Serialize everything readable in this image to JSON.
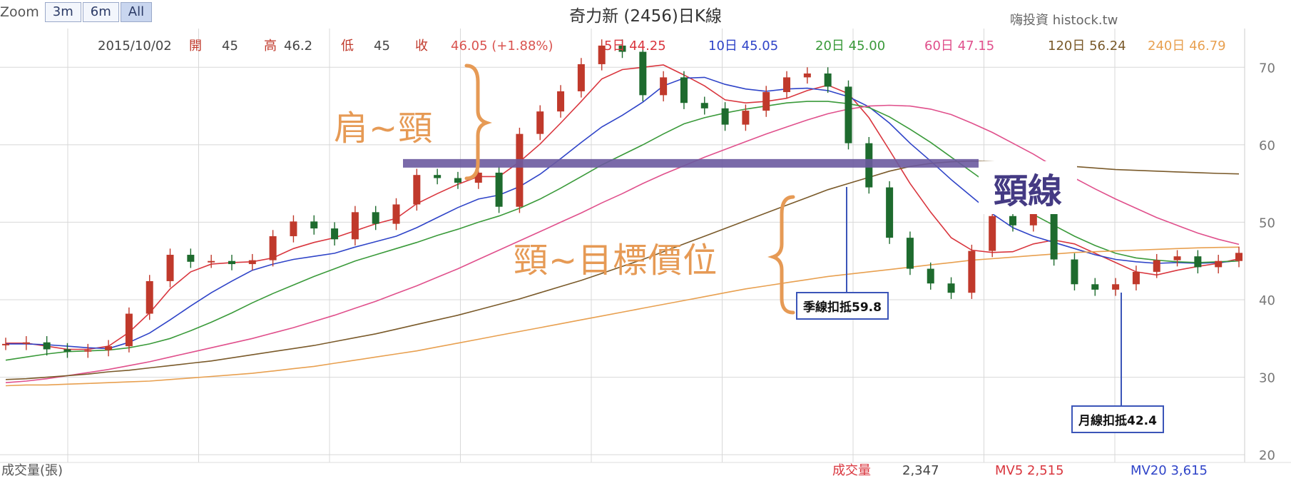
{
  "zoom": {
    "label": "Zoom",
    "buttons": [
      "3m",
      "6m",
      "All"
    ],
    "active": "All"
  },
  "title": "奇力新 (2456)日K線",
  "brand": "嗨投資 histock.tw",
  "info_bar": [
    {
      "text": "2015/10/02",
      "color": "#444444"
    },
    {
      "text": "開",
      "color": "#c0392b"
    },
    {
      "text": "45",
      "color": "#444444"
    },
    {
      "text": "高",
      "color": "#c0392b"
    },
    {
      "text": "46.2",
      "color": "#444444"
    },
    {
      "text": "低",
      "color": "#c0392b"
    },
    {
      "text": "45",
      "color": "#444444"
    },
    {
      "text": "收",
      "color": "#c0392b"
    },
    {
      "text": "46.05 (+1.88%)",
      "color": "#d9534f"
    },
    {
      "text": "5日 44.25",
      "color": "#d9363e"
    },
    {
      "text": "10日 45.05",
      "color": "#2f44c8"
    },
    {
      "text": "20日 45.00",
      "color": "#3a9a3a"
    },
    {
      "text": "60日 47.15",
      "color": "#e0508c"
    },
    {
      "text": "120日 56.24",
      "color": "#7a5a2a"
    },
    {
      "text": "240日 46.79",
      "color": "#e8a050"
    }
  ],
  "volume_bar": [
    {
      "text": "成交量(張)",
      "color": "#555555"
    },
    {
      "text": "成交量",
      "color": "#d9363e"
    },
    {
      "text": "2,347",
      "color": "#444444"
    },
    {
      "text": "MV5 2,515",
      "color": "#d9363e"
    },
    {
      "text": "MV20 3,615",
      "color": "#2f44c8"
    }
  ],
  "annotations": {
    "shoulder_neck": "肩~頸",
    "neck_target": "頸~目標價位",
    "neckline": "頸線",
    "quarter_deduct": "季線扣抵59.8",
    "month_deduct": "月線扣抵42.4"
  },
  "chart_data": {
    "type": "line",
    "title": "奇力新 (2456)日K線",
    "ylim": [
      19,
      75
    ],
    "yticks": [
      20,
      30,
      40,
      50,
      60,
      70
    ],
    "grid": true,
    "neckline_value": 57.6,
    "quarter_deduct_value": 59.8,
    "month_deduct_value": 42.4,
    "x": [
      0,
      1,
      2,
      3,
      4,
      5,
      6,
      7,
      8,
      9,
      10,
      11,
      12,
      13,
      14,
      15,
      16,
      17,
      18,
      19,
      20,
      21,
      22,
      23,
      24,
      25,
      26,
      27,
      28,
      29,
      30,
      31,
      32,
      33,
      34,
      35,
      36,
      37,
      38,
      39,
      40,
      41,
      42,
      43,
      44,
      45,
      46,
      47,
      48,
      49,
      50,
      51,
      52,
      53,
      54,
      55,
      56,
      57,
      58,
      59,
      60
    ],
    "close": [
      34.3,
      34.5,
      33.6,
      33.3,
      33.5,
      34.0,
      38.2,
      42.4,
      45.8,
      44.9,
      45.0,
      44.6,
      45.1,
      48.2,
      50.1,
      49.2,
      47.8,
      51.3,
      49.8,
      52.3,
      56.1,
      55.7,
      55.1,
      56.4,
      52.0,
      61.4,
      64.3,
      66.9,
      70.4,
      72.8,
      72.0,
      66.4,
      68.7,
      65.4,
      64.7,
      62.6,
      64.4,
      66.8,
      68.7,
      69.2,
      67.5,
      60.2,
      54.5,
      48.0,
      44.0,
      42.1,
      40.9,
      46.3,
      50.8,
      49.6,
      51.2,
      45.2,
      42.0,
      41.3,
      42.0,
      43.6,
      45.1,
      45.6,
      44.2,
      45.0,
      46.05
    ],
    "series": [
      {
        "name": "5日",
        "color": "#d9363e",
        "values": [
          34.4,
          34.4,
          34.0,
          33.6,
          33.6,
          34.0,
          35.8,
          38.3,
          41.4,
          43.6,
          44.6,
          44.8,
          44.9,
          45.4,
          46.6,
          47.4,
          48.0,
          48.9,
          49.8,
          50.5,
          52.4,
          53.7,
          54.9,
          55.9,
          55.9,
          57.8,
          60.1,
          62.8,
          65.6,
          68.5,
          69.7,
          70.0,
          70.3,
          69.0,
          67.6,
          65.8,
          65.4,
          65.6,
          66.0,
          67.0,
          67.7,
          66.6,
          63.5,
          59.3,
          55.0,
          51.3,
          48.0,
          46.4,
          46.1,
          46.2,
          47.2,
          47.7,
          47.2,
          46.0,
          44.8,
          43.6,
          43.2,
          43.8,
          44.3,
          44.7,
          45.3
        ]
      },
      {
        "name": "10日",
        "color": "#2f44c8",
        "values": [
          34.3,
          34.3,
          34.2,
          34.0,
          33.8,
          33.7,
          34.5,
          35.7,
          37.4,
          39.2,
          40.9,
          42.4,
          43.8,
          44.6,
          45.2,
          45.6,
          46.0,
          46.8,
          47.5,
          48.2,
          49.3,
          50.6,
          51.9,
          53.0,
          53.5,
          54.6,
          56.2,
          58.2,
          60.3,
          62.3,
          63.8,
          65.5,
          67.6,
          68.6,
          68.7,
          67.8,
          67.2,
          66.9,
          67.2,
          67.3,
          67.0,
          66.2,
          64.9,
          62.8,
          60.2,
          57.9,
          55.5,
          53.3,
          51.1,
          49.3,
          48.2,
          47.4,
          46.6,
          45.8,
          45.2,
          44.9,
          44.7,
          44.8,
          44.7,
          44.8,
          45.05
        ]
      },
      {
        "name": "20日",
        "color": "#3a9a3a",
        "values": [
          32.2,
          32.6,
          33.0,
          33.3,
          33.4,
          33.5,
          33.8,
          34.3,
          35.0,
          36.0,
          37.1,
          38.3,
          39.6,
          40.8,
          41.9,
          43.0,
          44.0,
          45.0,
          45.8,
          46.6,
          47.4,
          48.3,
          49.1,
          50.0,
          50.8,
          51.8,
          53.0,
          54.4,
          55.9,
          57.4,
          58.7,
          60.0,
          61.4,
          62.7,
          63.5,
          64.1,
          64.6,
          65.0,
          65.4,
          65.6,
          65.6,
          65.3,
          64.8,
          63.6,
          62.0,
          60.3,
          58.4,
          56.5,
          54.6,
          52.7,
          51.0,
          49.6,
          48.2,
          47.0,
          46.0,
          45.4,
          45.1,
          44.9,
          44.8,
          44.9,
          45.0
        ]
      },
      {
        "name": "60日",
        "color": "#e0508c",
        "values": [
          29.3,
          29.5,
          29.8,
          30.2,
          30.6,
          31.0,
          31.5,
          32.0,
          32.6,
          33.2,
          33.8,
          34.4,
          35.0,
          35.7,
          36.4,
          37.2,
          38.0,
          38.9,
          39.8,
          40.8,
          41.8,
          42.9,
          44.0,
          45.2,
          46.4,
          47.6,
          48.8,
          50.0,
          51.2,
          52.5,
          53.7,
          55.0,
          56.2,
          57.3,
          58.4,
          59.4,
          60.4,
          61.4,
          62.3,
          63.2,
          64.0,
          64.6,
          65.0,
          65.1,
          65.0,
          64.6,
          63.9,
          62.8,
          61.6,
          60.2,
          58.8,
          57.2,
          55.7,
          54.3,
          53.0,
          51.8,
          50.6,
          49.6,
          48.6,
          47.8,
          47.15
        ]
      },
      {
        "name": "120日",
        "color": "#7a5a2a",
        "values": [
          29.7,
          29.8,
          30.0,
          30.2,
          30.4,
          30.7,
          30.9,
          31.2,
          31.5,
          31.8,
          32.1,
          32.5,
          32.9,
          33.3,
          33.7,
          34.1,
          34.6,
          35.1,
          35.6,
          36.2,
          36.8,
          37.4,
          38.0,
          38.7,
          39.4,
          40.1,
          40.9,
          41.7,
          42.5,
          43.4,
          44.3,
          45.2,
          46.2,
          47.2,
          48.2,
          49.2,
          50.2,
          51.2,
          52.2,
          53.2,
          54.2,
          55.0,
          55.8,
          56.6,
          57.2,
          57.6,
          57.8,
          57.9,
          57.8,
          57.7,
          57.6,
          57.4,
          57.2,
          57.0,
          56.8,
          56.7,
          56.6,
          56.5,
          56.4,
          56.3,
          56.24
        ]
      },
      {
        "name": "240日",
        "color": "#e8a050",
        "values": [
          28.9,
          29.0,
          29.0,
          29.1,
          29.2,
          29.3,
          29.4,
          29.5,
          29.7,
          29.9,
          30.1,
          30.3,
          30.5,
          30.8,
          31.1,
          31.4,
          31.8,
          32.2,
          32.6,
          33.0,
          33.4,
          33.9,
          34.4,
          34.9,
          35.4,
          35.9,
          36.4,
          36.9,
          37.4,
          37.9,
          38.4,
          38.9,
          39.4,
          39.9,
          40.4,
          40.9,
          41.4,
          41.8,
          42.2,
          42.6,
          43.0,
          43.3,
          43.6,
          43.9,
          44.2,
          44.5,
          44.8,
          45.1,
          45.3,
          45.5,
          45.7,
          45.9,
          46.1,
          46.2,
          46.3,
          46.4,
          46.5,
          46.6,
          46.7,
          46.75,
          46.79
        ]
      }
    ]
  }
}
